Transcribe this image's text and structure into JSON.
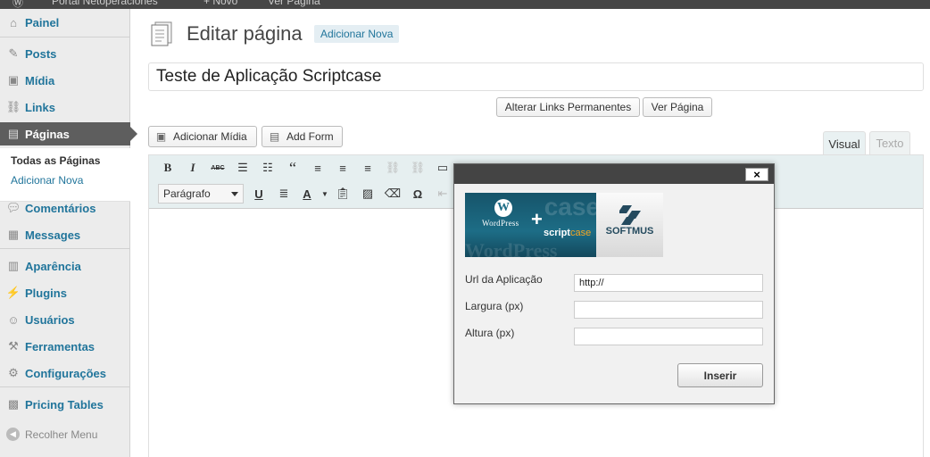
{
  "admin_bar": {
    "site_name": "Portal Netoperaciones",
    "new_label": "+ Novo",
    "view_label": "Ver Página"
  },
  "sidebar": {
    "items": [
      {
        "label": "Painel",
        "icon": "home-icon"
      },
      {
        "label": "Posts",
        "icon": "pin-icon"
      },
      {
        "label": "Mídia",
        "icon": "media-icon"
      },
      {
        "label": "Links",
        "icon": "link-icon"
      },
      {
        "label": "Páginas",
        "icon": "page-icon"
      },
      {
        "label": "Comentários",
        "icon": "comment-icon"
      },
      {
        "label": "Messages",
        "icon": "messages-icon"
      },
      {
        "label": "Aparência",
        "icon": "appearance-icon"
      },
      {
        "label": "Plugins",
        "icon": "plugin-icon"
      },
      {
        "label": "Usuários",
        "icon": "users-icon"
      },
      {
        "label": "Ferramentas",
        "icon": "tools-icon"
      },
      {
        "label": "Configurações",
        "icon": "settings-icon"
      },
      {
        "label": "Pricing Tables",
        "icon": "pricing-icon"
      }
    ],
    "submenu": [
      "Todas as Páginas",
      "Adicionar Nova"
    ],
    "collapse_label": "Recolher Menu"
  },
  "main": {
    "title": "Editar página",
    "add_new_label": "Adicionar Nova",
    "post_title": "Teste de Aplicação Scriptcase",
    "permalinks_button": "Alterar Links Permanentes",
    "view_page_button": "Ver Página",
    "add_media_button": "Adicionar Mídia",
    "add_form_button": "Add Form",
    "tabs": [
      "Visual",
      "Texto"
    ],
    "format_select": "Parágrafo"
  },
  "dialog": {
    "close_label": "×",
    "logo": {
      "wordpress_text": "WordPress",
      "plus": "+",
      "scriptcase_prefix": "script",
      "scriptcase_suffix": "case",
      "softmus_text": "SOFTMUS",
      "watermark": "WordPress",
      "bg_text": "case"
    },
    "fields": [
      {
        "label": "Url da Aplicação",
        "value": "http://"
      },
      {
        "label": "Largura (px)",
        "value": ""
      },
      {
        "label": "Altura (px)",
        "value": ""
      }
    ],
    "insert_button": "Inserir"
  }
}
